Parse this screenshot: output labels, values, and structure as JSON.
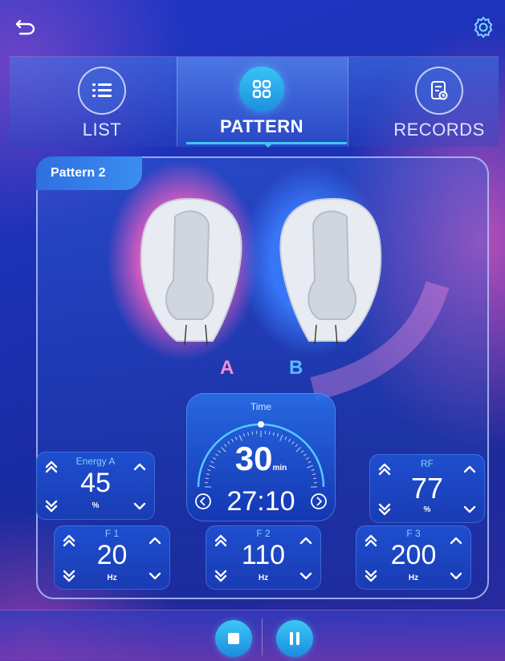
{
  "tabs": [
    {
      "label": "LIST",
      "icon": "list-icon"
    },
    {
      "label": "PATTERN",
      "icon": "grid-icon"
    },
    {
      "label": "RECORDS",
      "icon": "records-icon"
    }
  ],
  "active_tab": "PATTERN",
  "pattern": {
    "name": "Pattern 2"
  },
  "pads": {
    "a_label": "A",
    "b_label": "B"
  },
  "time": {
    "title": "Time",
    "total": "30",
    "total_unit": "min",
    "remaining": "27:10",
    "dial_fraction": 0.5
  },
  "energy_a": {
    "title": "Energy A",
    "value": "45",
    "unit": "%"
  },
  "rf": {
    "title": "RF",
    "value": "77",
    "unit": "%"
  },
  "f1": {
    "title": "F 1",
    "value": "20",
    "unit": "Hz"
  },
  "f2": {
    "title": "F 2",
    "value": "110",
    "unit": "Hz"
  },
  "f3": {
    "title": "F 3",
    "value": "200",
    "unit": "Hz"
  },
  "colors": {
    "accent": "#3cc8f5",
    "pad_a_glow": "#f25fc0",
    "pad_b_glow": "#3a7cff"
  },
  "icons": {
    "back": "back-arrow-icon",
    "settings": "gear-icon",
    "stop": "stop-icon",
    "pause": "pause-icon"
  }
}
